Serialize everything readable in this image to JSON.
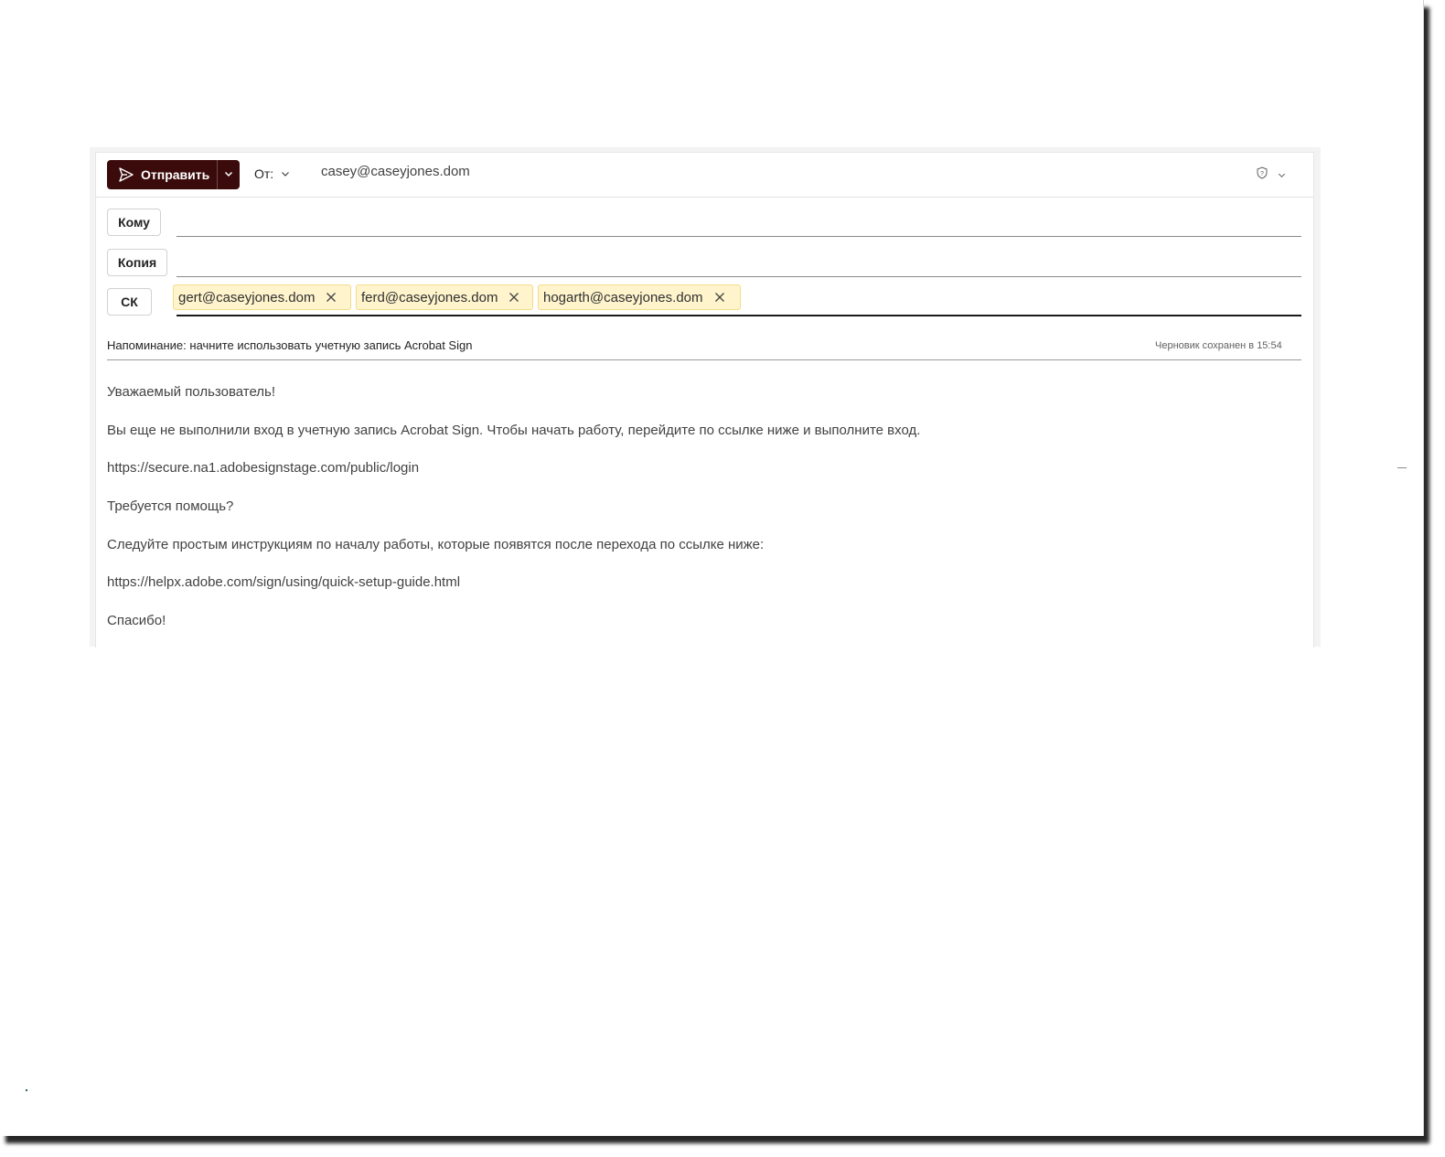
{
  "colors": {
    "send_button_bg": "#3b0a0a",
    "chip_bg": "#fff4cc",
    "chip_border": "#f1dd8b"
  },
  "toolbar": {
    "send_label": "Отправить",
    "send_icon": "send-icon",
    "send_dropdown_icon": "chevron-down-icon",
    "from_label": "От:",
    "from_address": "casey@caseyjones.dom",
    "sensitivity_icon": "sensitivity-icon"
  },
  "recipients": {
    "to_label": "Кому",
    "cc_label": "Копия",
    "bcc_label": "СК",
    "to": [],
    "cc": [],
    "bcc": [
      "gert@caseyjones.dom",
      "ferd@caseyjones.dom",
      "hogarth@caseyjones.dom"
    ]
  },
  "subject": "Напоминание: начните использовать учетную запись Acrobat Sign",
  "draft_status": "Черновик сохранен в 15:54",
  "body": [
    "Уважаемый пользователь!",
    "Вы еще не выполнили вход в учетную запись Acrobat Sign. Чтобы начать работу, перейдите по ссылке ниже и выполните вход.",
    "https://secure.na1.adobesignstage.com/public/login",
    "Требуется помощь?",
    "Следуйте простым инструкциям по началу работы, которые появятся после перехода по ссылке ниже:",
    "https://helpx.adobe.com/sign/using/quick-setup-guide.html",
    "Спасибо!"
  ]
}
